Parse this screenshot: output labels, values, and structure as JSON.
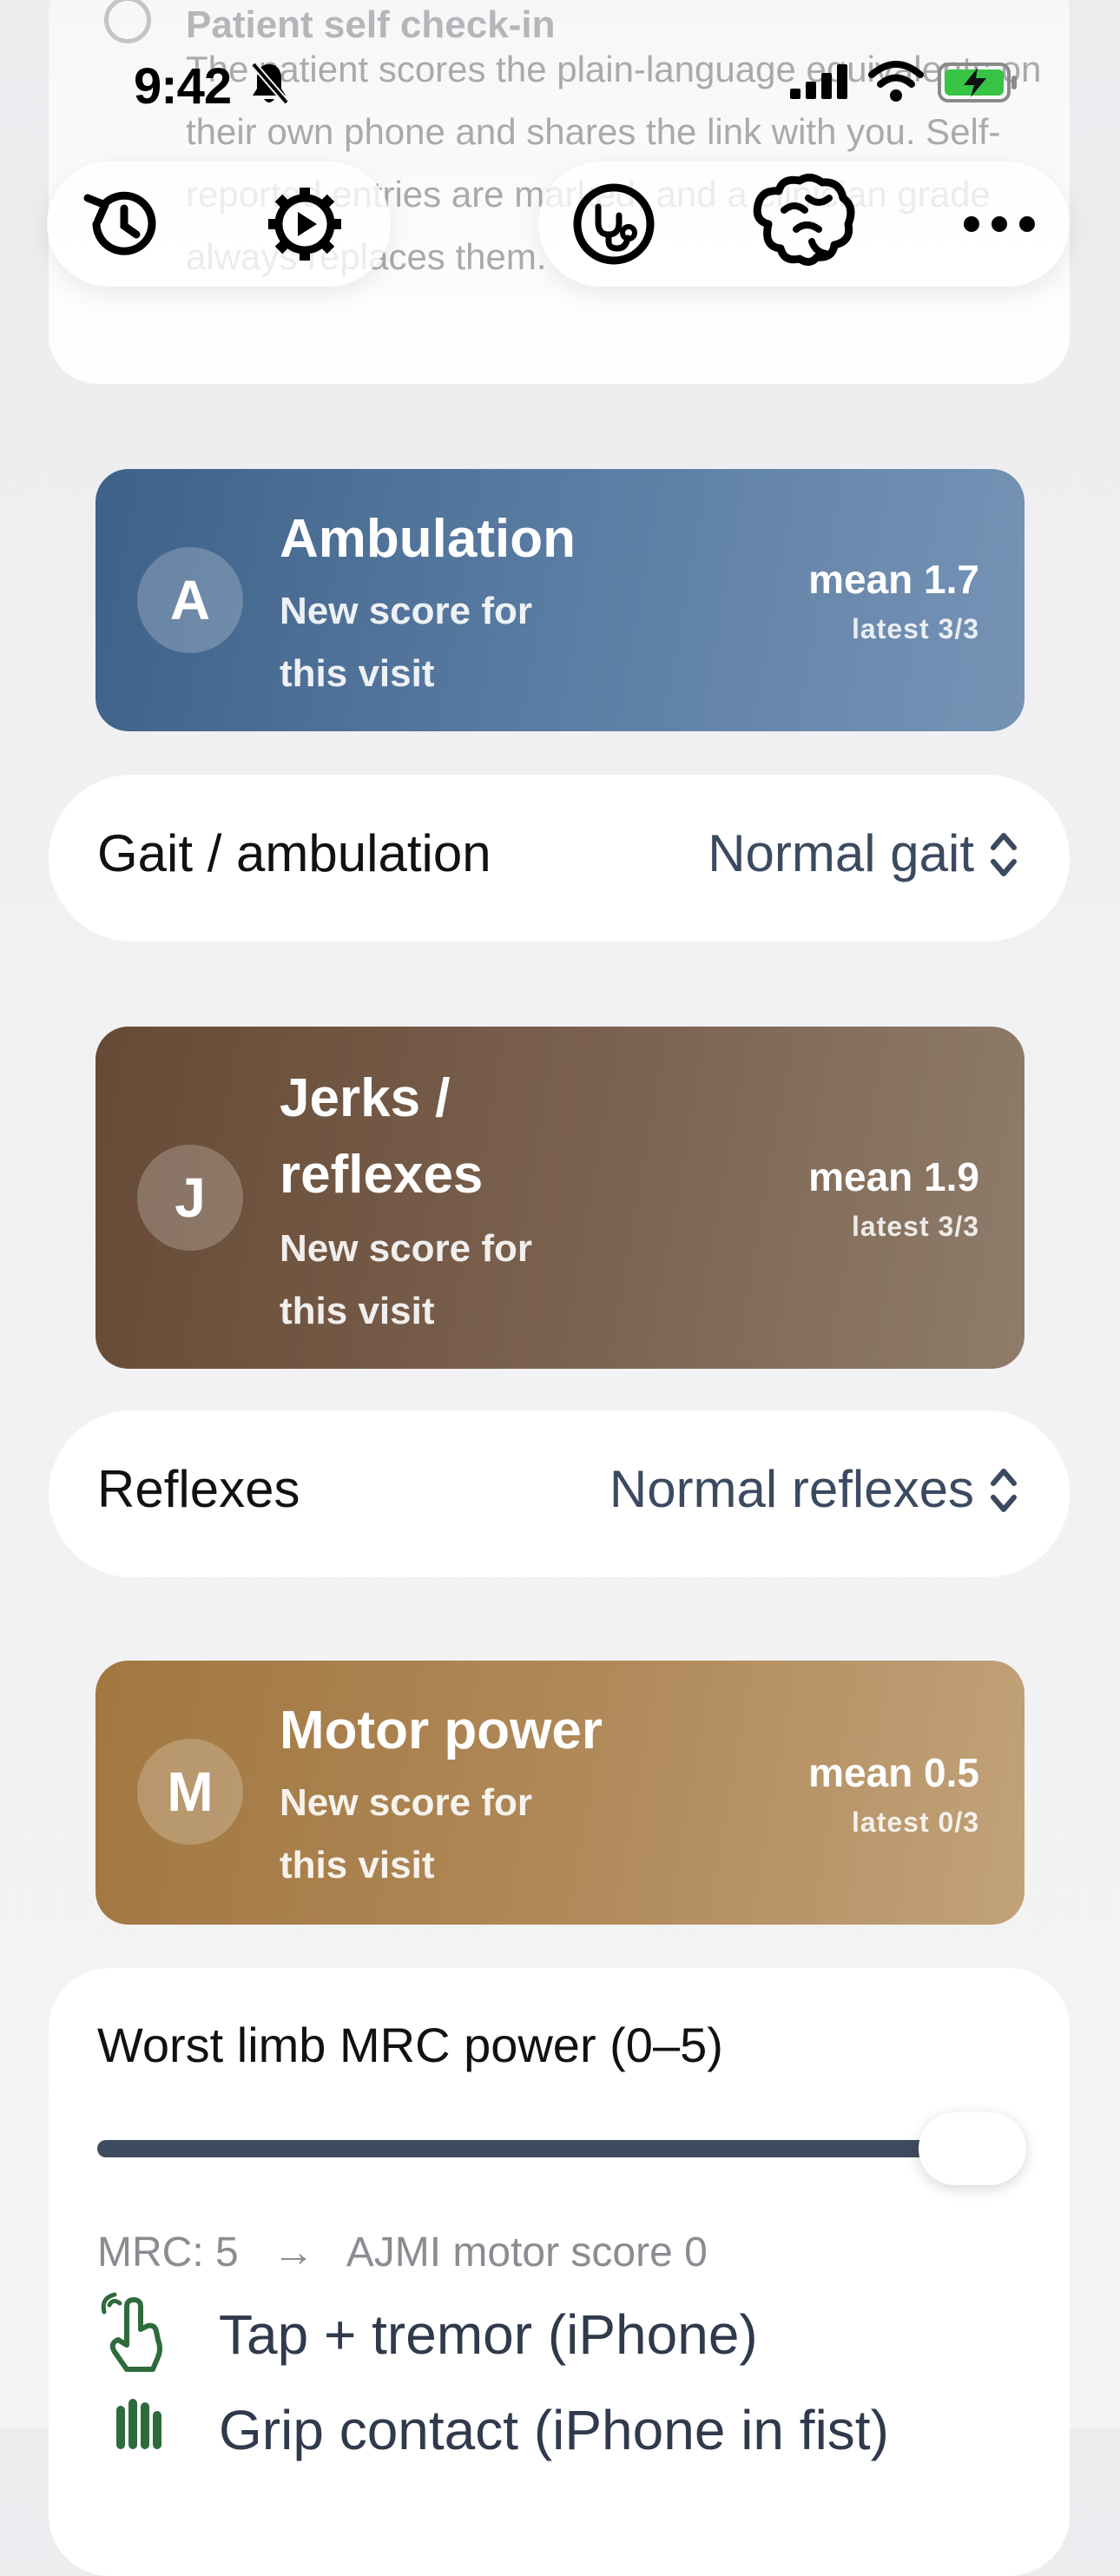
{
  "status_bar": {
    "time": "9:42"
  },
  "background_card": {
    "title": "Patient self check-in",
    "text": "The patient scores the plain-language equivalents on their own phone and shares the link with you. Self-reported entries are marked, and a clinician grade always replaces them."
  },
  "toolbar": {
    "left_icons": [
      "history-icon",
      "settings-play-icon"
    ],
    "right_icons": [
      "stethoscope-icon",
      "brain-icon",
      "more-icon"
    ]
  },
  "cards": {
    "ambulation": {
      "initial": "A",
      "title": "Ambulation",
      "subtitle": "New score for this visit",
      "mean": "mean 1.7",
      "latest": "latest 3/3",
      "color": "#4a6c93"
    },
    "jerks": {
      "initial": "J",
      "title_line1": "Jerks /",
      "title_line2": "reflexes",
      "subtitle": "New score for this visit",
      "mean": "mean 1.9",
      "latest": "latest 3/3",
      "color": "#735845"
    },
    "motor": {
      "initial": "M",
      "title": "Motor power",
      "subtitle": "New score for this visit",
      "mean": "mean 0.5",
      "latest": "latest 0/3",
      "color": "#a9814f"
    }
  },
  "rows": {
    "gait": {
      "label": "Gait / ambulation",
      "value": "Normal gait"
    },
    "reflexes": {
      "label": "Reflexes",
      "value": "Normal reflexes"
    }
  },
  "motor_slider": {
    "title": "Worst limb MRC power (0–5)",
    "value": 5,
    "max": 5,
    "mrc_text": "MRC: 5",
    "arrow": "→",
    "ajmi_text": "AJMI motor score 0"
  },
  "actions": {
    "tap_tremor": "Tap + tremor (iPhone)",
    "grip": "Grip contact (iPhone in fist)"
  },
  "colors": {
    "accent": "#3f4b5f",
    "green_icon": "#2e6b3c"
  }
}
